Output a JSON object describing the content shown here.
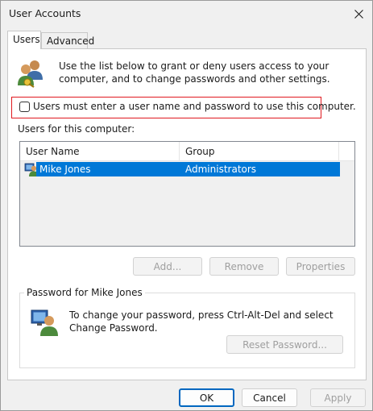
{
  "window": {
    "title": "User Accounts"
  },
  "tabs": [
    {
      "label": "Users",
      "active": true
    },
    {
      "label": "Advanced",
      "active": false
    }
  ],
  "intro": {
    "text": "Use the list below to grant or deny users access to your computer, and to change passwords and other settings."
  },
  "require_login": {
    "label": "Users must enter a user name and password to use this computer.",
    "checked": false
  },
  "users_list": {
    "label": "Users for this computer:",
    "columns": [
      "User Name",
      "Group"
    ],
    "rows": [
      {
        "user_name": "Mike Jones",
        "group": "Administrators",
        "selected": true
      }
    ]
  },
  "list_buttons": {
    "add": "Add...",
    "remove": "Remove",
    "properties": "Properties"
  },
  "password_group": {
    "title": "Password for Mike Jones",
    "text": "To change your password, press Ctrl-Alt-Del and select Change Password.",
    "reset_button": "Reset Password..."
  },
  "footer": {
    "ok": "OK",
    "cancel": "Cancel",
    "apply": "Apply"
  },
  "colors": {
    "selection": "#0078d7",
    "highlight_border": "#e0191f",
    "default_button_border": "#0067c0"
  },
  "icons": {
    "users": "users-icon",
    "user_row": "user-icon",
    "password": "user-key-icon",
    "close": "close-icon"
  }
}
